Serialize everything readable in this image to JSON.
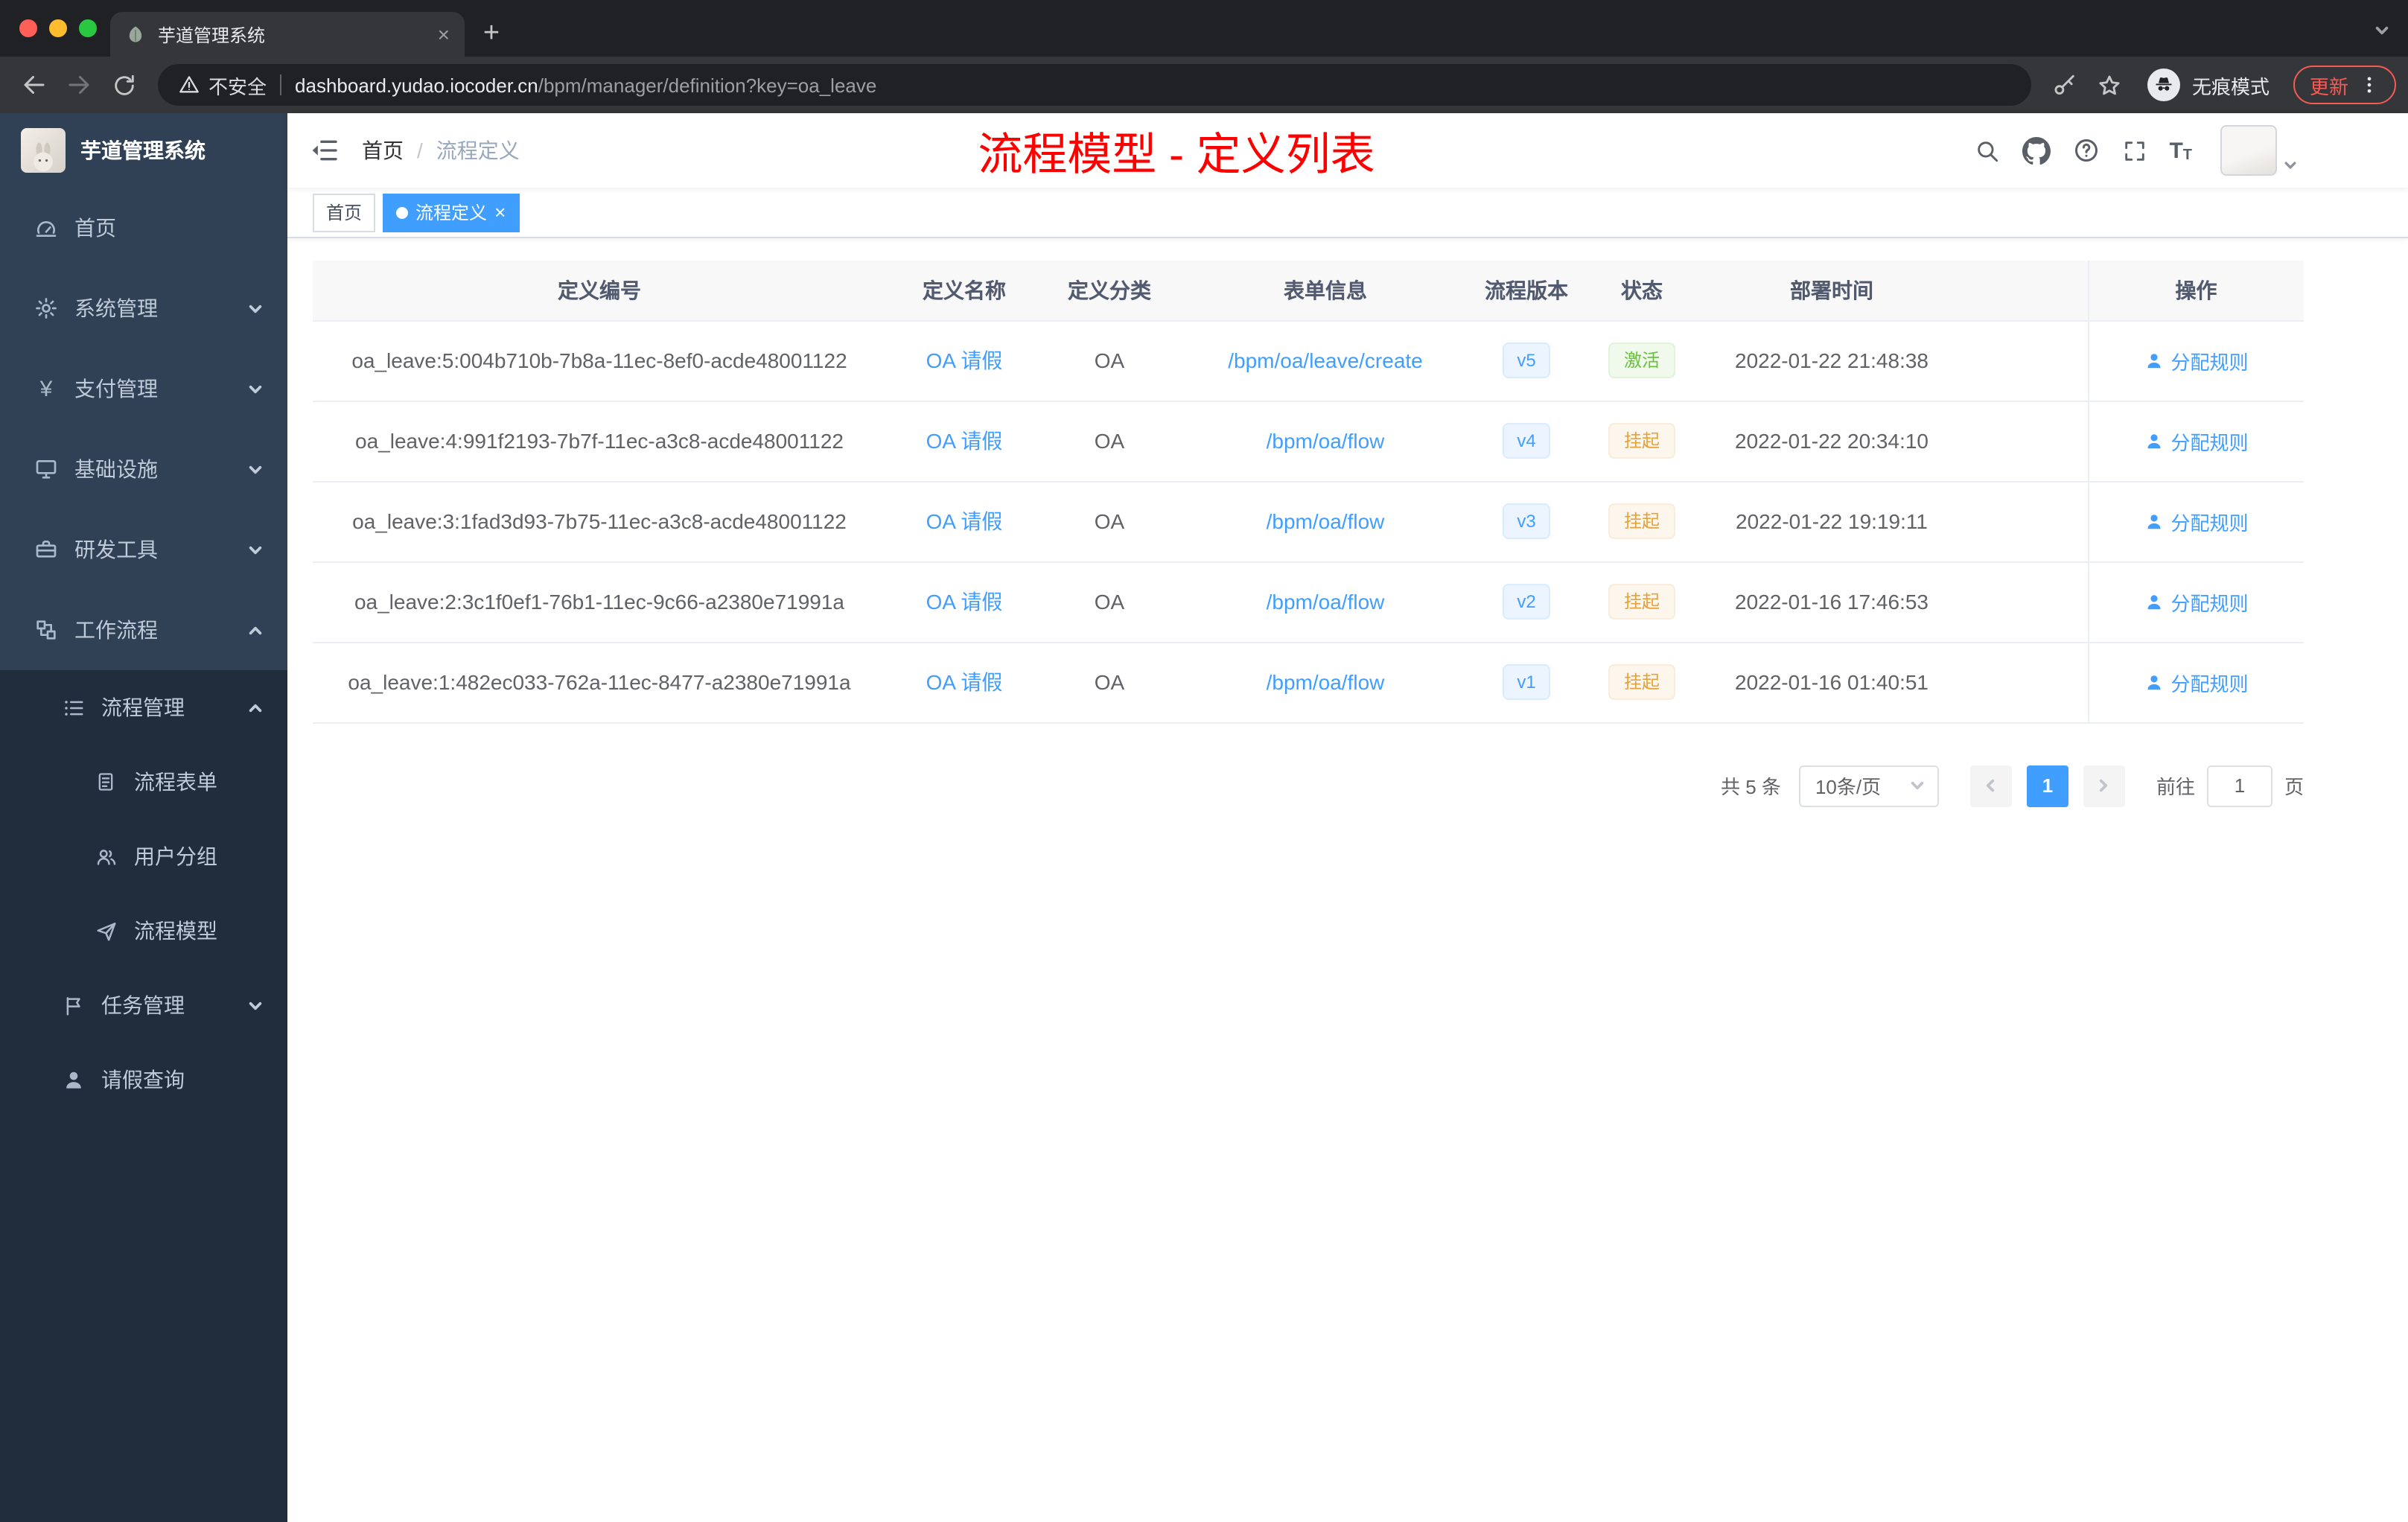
{
  "colors": {
    "accent": "#409eff",
    "page_title_red": "#ff0000",
    "status_success": "#67c23a",
    "status_warning": "#e6a23c",
    "sidebar_bg": "#304156",
    "submenu_bg": "#1f2d3d"
  },
  "browser": {
    "tab": {
      "title": "芋道管理系统"
    },
    "address": {
      "security": "不安全",
      "host": "dashboard.yudao.iocoder.cn",
      "path": "/bpm/manager/definition?key=oa_leave"
    },
    "incognito_label": "无痕模式",
    "update_label": "更新"
  },
  "sidebar": {
    "logo_title": "芋道管理系统",
    "menu": [
      {
        "label": "首页"
      },
      {
        "label": "系统管理"
      },
      {
        "label": "支付管理"
      },
      {
        "label": "基础设施"
      },
      {
        "label": "研发工具"
      },
      {
        "label": "工作流程"
      },
      {
        "label": "流程管理"
      },
      {
        "label": "流程表单"
      },
      {
        "label": "用户分组"
      },
      {
        "label": "流程模型"
      },
      {
        "label": "任务管理"
      },
      {
        "label": "请假查询"
      }
    ]
  },
  "header": {
    "breadcrumb": {
      "home": "首页",
      "separator": "/",
      "current": "流程定义"
    },
    "page_title": "流程模型 - 定义列表"
  },
  "tags": {
    "home": "首页",
    "active": "流程定义",
    "close": "×"
  },
  "table": {
    "columns": [
      "定义编号",
      "定义名称",
      "定义分类",
      "表单信息",
      "流程版本",
      "状态",
      "部署时间",
      "操作"
    ],
    "rows": [
      {
        "id": "oa_leave:5:004b710b-7b8a-11ec-8ef0-acde48001122",
        "name": "OA 请假",
        "category": "OA",
        "form": "/bpm/oa/leave/create",
        "version": "v5",
        "status": "激活",
        "status_type": "success",
        "time": "2022-01-22 21:48:38",
        "action": "分配规则"
      },
      {
        "id": "oa_leave:4:991f2193-7b7f-11ec-a3c8-acde48001122",
        "name": "OA 请假",
        "category": "OA",
        "form": "/bpm/oa/flow",
        "version": "v4",
        "status": "挂起",
        "status_type": "warning",
        "time": "2022-01-22 20:34:10",
        "action": "分配规则"
      },
      {
        "id": "oa_leave:3:1fad3d93-7b75-11ec-a3c8-acde48001122",
        "name": "OA 请假",
        "category": "OA",
        "form": "/bpm/oa/flow",
        "version": "v3",
        "status": "挂起",
        "status_type": "warning",
        "time": "2022-01-22 19:19:11",
        "action": "分配规则"
      },
      {
        "id": "oa_leave:2:3c1f0ef1-76b1-11ec-9c66-a2380e71991a",
        "name": "OA 请假",
        "category": "OA",
        "form": "/bpm/oa/flow",
        "version": "v2",
        "status": "挂起",
        "status_type": "warning",
        "time": "2022-01-16 17:46:53",
        "action": "分配规则"
      },
      {
        "id": "oa_leave:1:482ec033-762a-11ec-8477-a2380e71991a",
        "name": "OA 请假",
        "category": "OA",
        "form": "/bpm/oa/flow",
        "version": "v1",
        "status": "挂起",
        "status_type": "warning",
        "time": "2022-01-16 01:40:51",
        "action": "分配规则"
      }
    ]
  },
  "pagination": {
    "total": "共 5 条",
    "page_size": "10条/页",
    "current_page": "1",
    "goto_label": "前往",
    "goto_value": "1",
    "page_unit": "页"
  }
}
